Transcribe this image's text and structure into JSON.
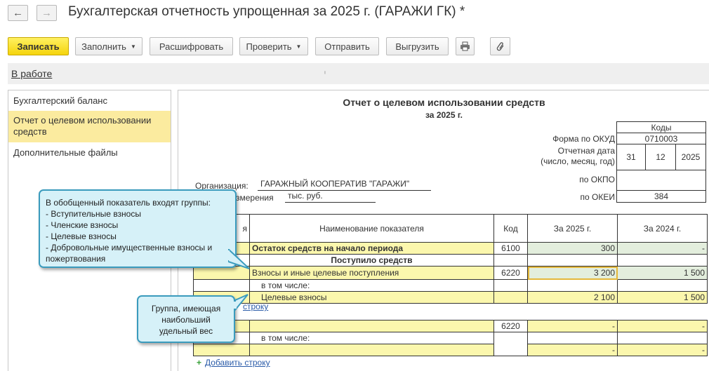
{
  "window": {
    "title": "Бухгалтерская отчетность упрощенная за 2025 г. (ГАРАЖИ ГК) *",
    "back_icon": "arrow-left-icon",
    "forward_icon": "arrow-right-icon"
  },
  "toolbar": {
    "save_label": "Записать",
    "fill_label": "Заполнить",
    "decode_label": "Расшифровать",
    "check_label": "Проверить",
    "send_label": "Отправить",
    "export_label": "Выгрузить",
    "print_icon": "printer-icon",
    "attach_icon": "paperclip-icon"
  },
  "status": {
    "link": "В работе",
    "mark": "ⁱ"
  },
  "sidebar": {
    "items": [
      {
        "label": "Бухгалтерский баланс"
      },
      {
        "label": "Отчет о целевом использовании средств"
      },
      {
        "label": "Дополнительные файлы"
      }
    ]
  },
  "report": {
    "title": "Отчет о целевом использовании средств",
    "period": "за 2025 г.",
    "codes_header": "Коды",
    "okud_label": "Форма по ОКУД",
    "okud_value": "0710003",
    "date_label_1": "Отчетная дата",
    "date_label_2": "(число, месяц, год)",
    "date_day": "31",
    "date_month": "12",
    "date_year": "2025",
    "okpo_label": "по ОКПО",
    "okpo_value": "",
    "okei_label": "по ОКЕИ",
    "okei_value": "384",
    "org_label": "Организация:",
    "org_value": "ГАРАЖНЫЙ КООПЕРАТИВ \"ГАРАЖИ\"",
    "unit_label_tail": "змерения",
    "unit_value": "тыс. руб.",
    "col_frag": "я",
    "col_name": "Наименование показателя",
    "col_code": "Код",
    "col_2025": "За 2025 г.",
    "col_2024": "За 2024 г.",
    "rows": {
      "start_label": "Остаток средств на начало периода",
      "start_code": "6100",
      "start_2025": "300",
      "start_2024": "-",
      "received_label": "Поступило средств",
      "fees_label": "Взносы и иные целевые поступления",
      "fees_code": "6220",
      "fees_2025": "3 200",
      "fees_2024": "1 500",
      "incl_label": "в том числе:",
      "target_label": "Целевые взносы",
      "target_2025": "2 100",
      "target_2024": "1 500",
      "add_row_1": "строку",
      "row2_code": "6220",
      "row2_2025": "-",
      "row2_2024": "-",
      "incl2_label": "в том числе:",
      "incl2_2025": "-",
      "incl2_2024": "-",
      "add_row_2": "Добавить строку"
    }
  },
  "callouts": {
    "groups": {
      "lines": [
        "В обобщенный показатель входят группы:",
        "- Вступительные взносы",
        "- Членские взносы",
        "- Целевые взносы",
        "- Добровольные имущественные взносы и",
        "пожертвования"
      ]
    },
    "largest": {
      "lines": [
        "Группа, имеющая",
        "наибольший",
        "удельный вес"
      ]
    }
  },
  "colors": {
    "accent_yellow": "#f5d40c",
    "callout_bg": "#d6f1f8",
    "callout_border": "#3a9bbd",
    "row_yellow": "#fbf7ad",
    "row_green": "#e3eedd",
    "link_blue": "#2a5ba8"
  }
}
